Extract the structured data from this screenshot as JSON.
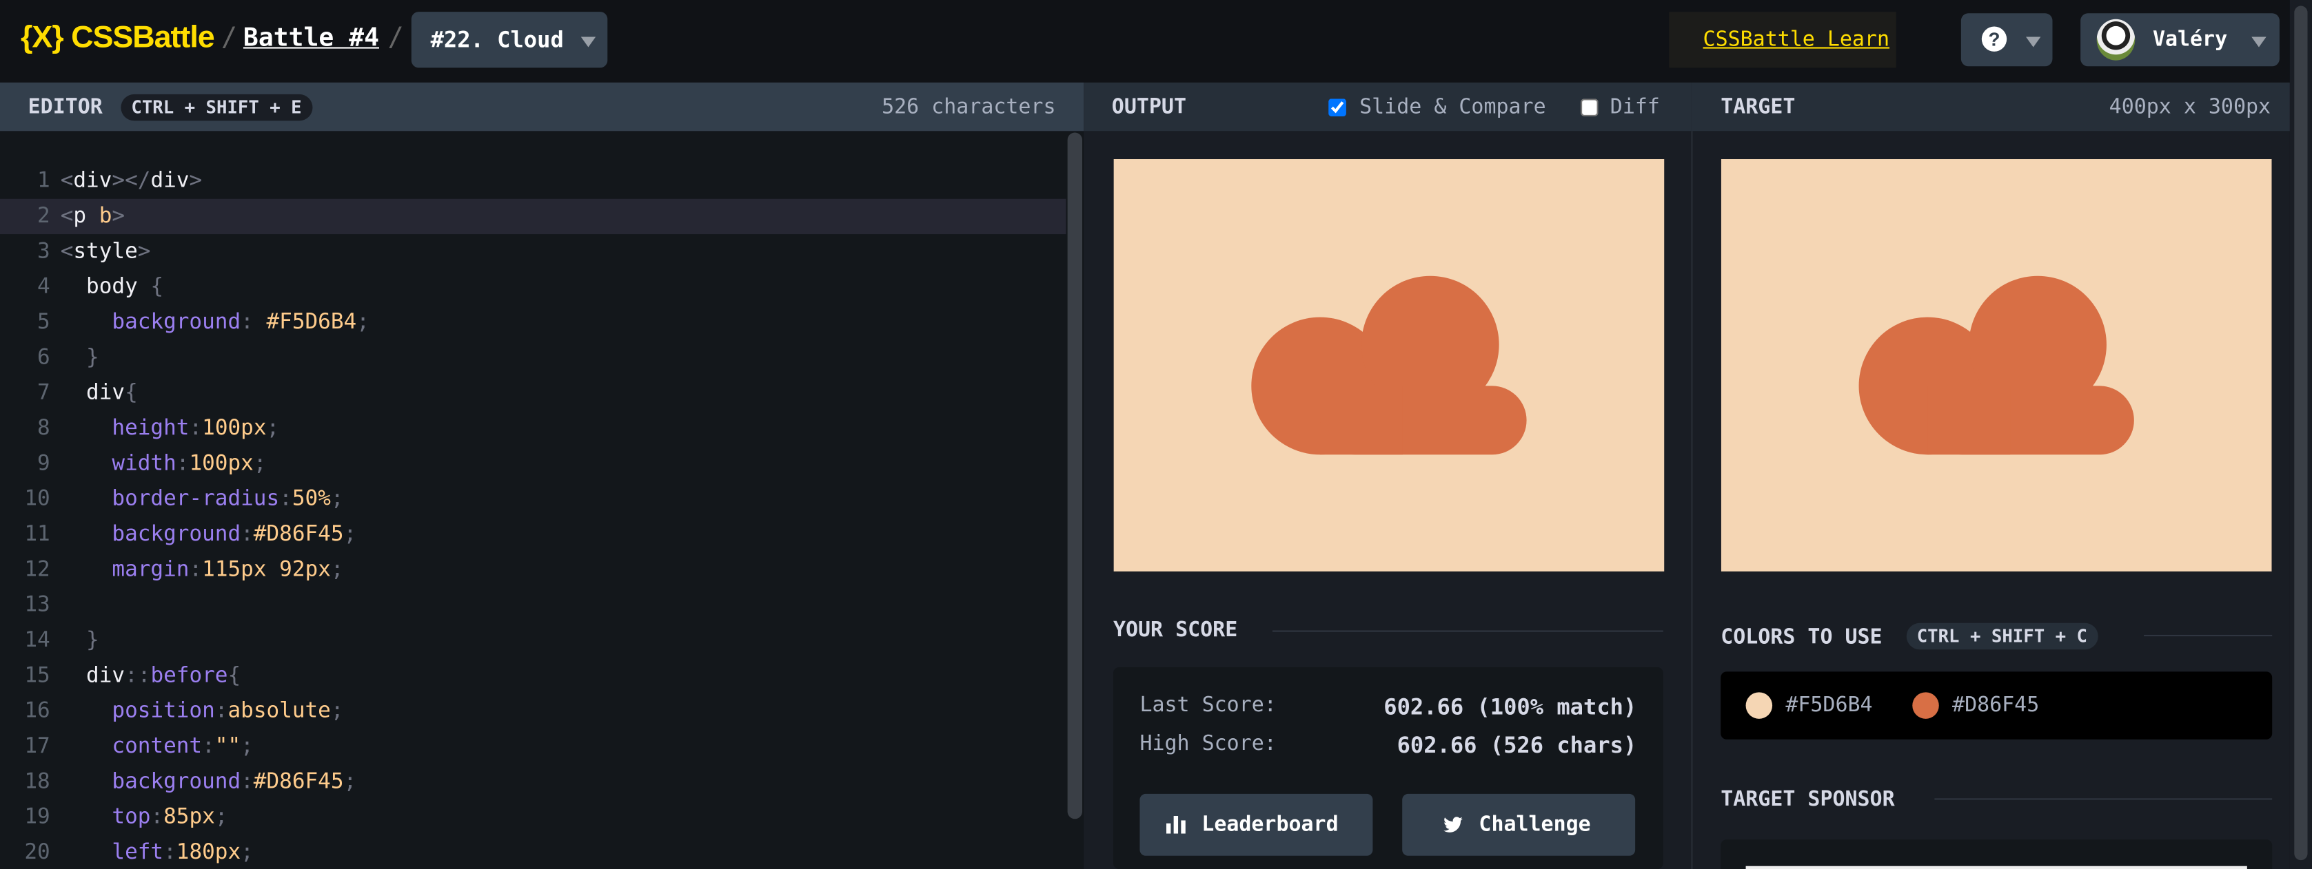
{
  "header": {
    "logo_text": "CSSBattle",
    "logo_glyph": "{X}",
    "separator": "/",
    "battle_link": "Battle #4",
    "level_select": "#22. Cloud",
    "learn_link": "CSSBattle Learn",
    "help_icon": "question-icon",
    "help_glyph": "?",
    "user_name": "Valéry"
  },
  "editor": {
    "title": "EDITOR",
    "shortcut": "CTRL + SHIFT + E",
    "char_count": "526 characters",
    "active_line": 2,
    "lines": [
      {
        "n": "1",
        "tokens": [
          {
            "c": "punc",
            "t": "<"
          },
          {
            "c": "tag",
            "t": "div"
          },
          {
            "c": "punc",
            "t": "></"
          },
          {
            "c": "tag",
            "t": "div"
          },
          {
            "c": "punc",
            "t": ">"
          }
        ]
      },
      {
        "n": "2",
        "tokens": [
          {
            "c": "punc",
            "t": "<"
          },
          {
            "c": "tag",
            "t": "p "
          },
          {
            "c": "val",
            "t": "b"
          },
          {
            "c": "punc",
            "t": ">"
          }
        ]
      },
      {
        "n": "3",
        "tokens": [
          {
            "c": "punc",
            "t": "<"
          },
          {
            "c": "tag",
            "t": "style"
          },
          {
            "c": "punc",
            "t": ">"
          }
        ]
      },
      {
        "n": "4",
        "tokens": [
          {
            "c": "sel",
            "t": "  body "
          },
          {
            "c": "punc",
            "t": "{"
          }
        ]
      },
      {
        "n": "5",
        "tokens": [
          {
            "c": "prop",
            "t": "    background"
          },
          {
            "c": "punc",
            "t": ": "
          },
          {
            "c": "val",
            "t": "#F5D6B4"
          },
          {
            "c": "punc",
            "t": ";"
          }
        ]
      },
      {
        "n": "6",
        "tokens": [
          {
            "c": "punc",
            "t": "  }"
          }
        ]
      },
      {
        "n": "7",
        "tokens": [
          {
            "c": "sel",
            "t": "  div"
          },
          {
            "c": "punc",
            "t": "{"
          }
        ]
      },
      {
        "n": "8",
        "tokens": [
          {
            "c": "prop",
            "t": "    height"
          },
          {
            "c": "punc",
            "t": ":"
          },
          {
            "c": "val",
            "t": "100px"
          },
          {
            "c": "punc",
            "t": ";"
          }
        ]
      },
      {
        "n": "9",
        "tokens": [
          {
            "c": "prop",
            "t": "    width"
          },
          {
            "c": "punc",
            "t": ":"
          },
          {
            "c": "val",
            "t": "100px"
          },
          {
            "c": "punc",
            "t": ";"
          }
        ]
      },
      {
        "n": "10",
        "tokens": [
          {
            "c": "prop",
            "t": "    border-radius"
          },
          {
            "c": "punc",
            "t": ":"
          },
          {
            "c": "val",
            "t": "50%"
          },
          {
            "c": "punc",
            "t": ";"
          }
        ]
      },
      {
        "n": "11",
        "tokens": [
          {
            "c": "prop",
            "t": "    background"
          },
          {
            "c": "punc",
            "t": ":"
          },
          {
            "c": "val",
            "t": "#D86F45"
          },
          {
            "c": "punc",
            "t": ";"
          }
        ]
      },
      {
        "n": "12",
        "tokens": [
          {
            "c": "prop",
            "t": "    margin"
          },
          {
            "c": "punc",
            "t": ":"
          },
          {
            "c": "val",
            "t": "115px 92px"
          },
          {
            "c": "punc",
            "t": ";"
          }
        ]
      },
      {
        "n": "13",
        "tokens": []
      },
      {
        "n": "14",
        "tokens": [
          {
            "c": "punc",
            "t": "  }"
          }
        ]
      },
      {
        "n": "15",
        "tokens": [
          {
            "c": "sel",
            "t": "  div"
          },
          {
            "c": "punc",
            "t": "::"
          },
          {
            "c": "pseudo",
            "t": "before"
          },
          {
            "c": "punc",
            "t": "{"
          }
        ]
      },
      {
        "n": "16",
        "tokens": [
          {
            "c": "prop",
            "t": "    position"
          },
          {
            "c": "punc",
            "t": ":"
          },
          {
            "c": "val",
            "t": "absolute"
          },
          {
            "c": "punc",
            "t": ";"
          }
        ]
      },
      {
        "n": "17",
        "tokens": [
          {
            "c": "prop",
            "t": "    content"
          },
          {
            "c": "punc",
            "t": ":"
          },
          {
            "c": "val",
            "t": "\"\""
          },
          {
            "c": "punc",
            "t": ";"
          }
        ]
      },
      {
        "n": "18",
        "tokens": [
          {
            "c": "prop",
            "t": "    background"
          },
          {
            "c": "punc",
            "t": ":"
          },
          {
            "c": "val",
            "t": "#D86F45"
          },
          {
            "c": "punc",
            "t": ";"
          }
        ]
      },
      {
        "n": "19",
        "tokens": [
          {
            "c": "prop",
            "t": "    top"
          },
          {
            "c": "punc",
            "t": ":"
          },
          {
            "c": "val",
            "t": "85px"
          },
          {
            "c": "punc",
            "t": ";"
          }
        ]
      },
      {
        "n": "20",
        "tokens": [
          {
            "c": "prop",
            "t": "    left"
          },
          {
            "c": "punc",
            "t": ":"
          },
          {
            "c": "val",
            "t": "180px"
          },
          {
            "c": "punc",
            "t": ";"
          }
        ]
      }
    ]
  },
  "output": {
    "title": "OUTPUT",
    "slide_compare_label": "Slide & Compare",
    "slide_compare_checked": true,
    "diff_label": "Diff",
    "diff_checked": false
  },
  "target": {
    "title": "TARGET",
    "dimensions": "400px x 300px"
  },
  "score": {
    "title": "YOUR SCORE",
    "last_label": "Last Score:",
    "last_value": "602.66 (100% match)",
    "high_label": "High Score:",
    "high_value": "602.66 (526 chars)",
    "leaderboard_button": "Leaderboard",
    "challenge_button": "Challenge"
  },
  "colors_to_use": {
    "title": "COLORS TO USE",
    "shortcut": "CTRL + SHIFT + C",
    "colors": [
      {
        "hex": "#F5D6B4"
      },
      {
        "hex": "#D86F45"
      }
    ]
  },
  "sponsor": {
    "title": "TARGET SPONSOR"
  },
  "theme": {
    "bg": "#F5D6B4",
    "fg": "#D86F45",
    "accent": "#ffdd00"
  }
}
